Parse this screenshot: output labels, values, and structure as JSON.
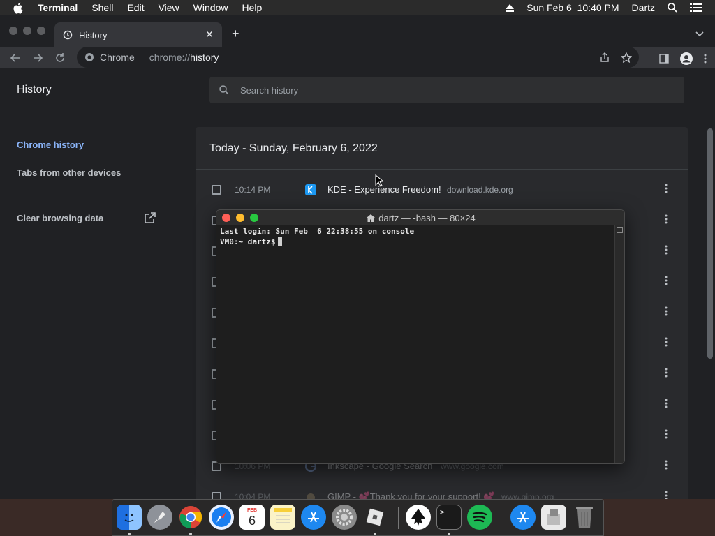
{
  "menubar": {
    "app_name": "Terminal",
    "items": [
      "Shell",
      "Edit",
      "View",
      "Window",
      "Help"
    ],
    "datetime": "Sun Feb 6  10:40 PM",
    "user": "Dartz"
  },
  "browser": {
    "tab_title": "History",
    "omnibox": {
      "chip": "Chrome",
      "scheme": "chrome://",
      "host": "history"
    }
  },
  "history_page": {
    "title": "History",
    "search_placeholder": "Search history",
    "sidebar": {
      "chrome_history": "Chrome history",
      "tabs_other_devices": "Tabs from other devices",
      "clear_browsing_data": "Clear browsing data"
    },
    "date_heading": "Today - Sunday, February 6, 2022",
    "entries": [
      {
        "time": "10:14 PM",
        "title": "KDE - Experience Freedom!",
        "domain": "download.kde.org",
        "favicon": "kde-icon"
      },
      {
        "time": "10:06 PM",
        "title": "Inkscape - Google Search",
        "domain": "www.google.com",
        "favicon": "google-icon"
      },
      {
        "time": "10:04 PM",
        "title": "GIMP - 💕Thank you for your support! 💕",
        "domain": "www.gimp.org",
        "favicon": "gimp-icon"
      }
    ]
  },
  "terminal": {
    "title": "dartz — -bash — 80×24",
    "lines": [
      "Last login: Sun Feb  6 22:38:55 on console",
      "VM0:~ dartz$"
    ]
  },
  "dock": {
    "apps": [
      "finder-icon",
      "launchpad-icon",
      "chrome-icon",
      "safari-icon",
      "calendar-icon",
      "notes-icon",
      "app-store-icon",
      "system-preferences-icon",
      "roblox-icon",
      "inkscape-icon",
      "terminal-icon",
      "spotify-icon",
      "app-store-downloads-icon",
      "preview-icon",
      "trash-icon"
    ],
    "calendar_month": "FEB",
    "calendar_day": "6"
  },
  "colors": {
    "chrome_accent": "#8ab4f8",
    "page_bg": "#202124",
    "card_bg": "#292a2d",
    "terminal_bg": "#1e1e1e"
  }
}
